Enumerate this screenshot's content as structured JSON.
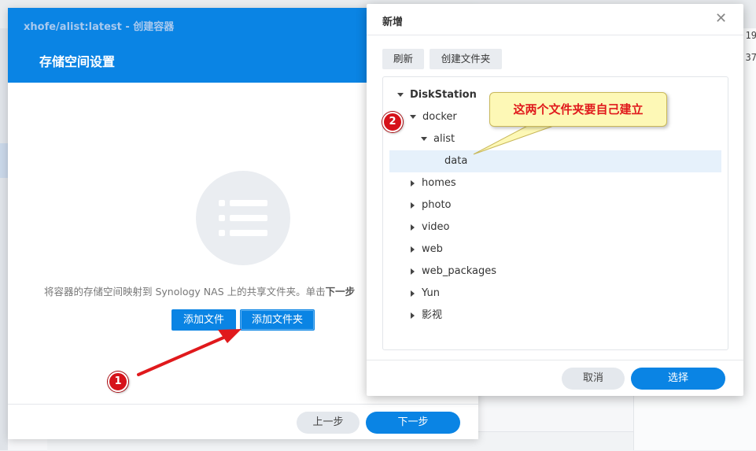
{
  "background": {
    "right_numbers": [
      ":19",
      ":37"
    ]
  },
  "wizard": {
    "title": "xhofe/alist:latest - 创建容器",
    "heading": "存储空间设置",
    "description_prefix": "将容器的存储空间映射到 Synology NAS 上的共享文件夹。单击",
    "description_bold": "下一步",
    "add_file_button": "添加文件",
    "add_folder_button": "添加文件夹",
    "prev_button": "上一步",
    "next_button": "下一步"
  },
  "dialog": {
    "title": "新增",
    "close_glyph": "✕",
    "refresh_button": "刷新",
    "create_folder_button": "创建文件夹",
    "tree": {
      "root": "DiskStation",
      "docker": "docker",
      "alist": "alist",
      "data": "data",
      "siblings": [
        "homes",
        "photo",
        "video",
        "web",
        "web_packages",
        "Yun",
        "影视"
      ]
    },
    "cancel_button": "取消",
    "select_button": "选择"
  },
  "annotations": {
    "callout": "这两个文件夹要自己建立",
    "badge_1": "1",
    "badge_2": "2",
    "arrow_color": "#e0191c"
  }
}
